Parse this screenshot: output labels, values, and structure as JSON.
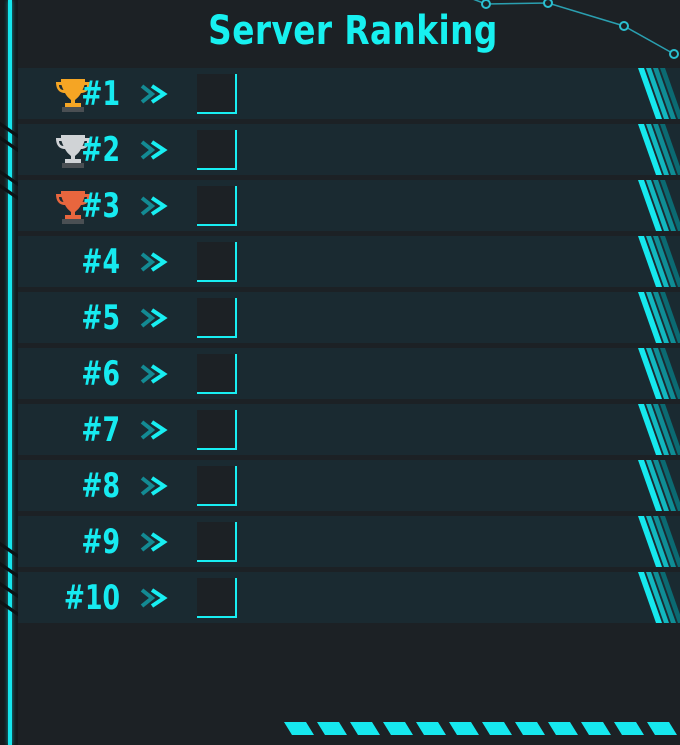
{
  "header": {
    "title": "Server Ranking"
  },
  "ranking": {
    "rows": [
      {
        "rank_label": "#1",
        "trophy": "gold-trophy-icon",
        "trophy_color": "#f5a524"
      },
      {
        "rank_label": "#2",
        "trophy": "silver-trophy-icon",
        "trophy_color": "#d0d3d6"
      },
      {
        "rank_label": "#3",
        "trophy": "bronze-trophy-icon",
        "trophy_color": "#e8663e"
      },
      {
        "rank_label": "#4"
      },
      {
        "rank_label": "#5"
      },
      {
        "rank_label": "#6"
      },
      {
        "rank_label": "#7"
      },
      {
        "rank_label": "#8"
      },
      {
        "rank_label": "#9"
      },
      {
        "rank_label": "#10"
      }
    ]
  },
  "icons": {
    "row_arrow": "double-chevron-right-icon",
    "avatar_slot": "avatar-frame",
    "row_decoration": "diagonal-stripes"
  },
  "colors": {
    "accent": "#17f0f0",
    "background": "#1c2125",
    "row_background": "#1a2a31"
  }
}
